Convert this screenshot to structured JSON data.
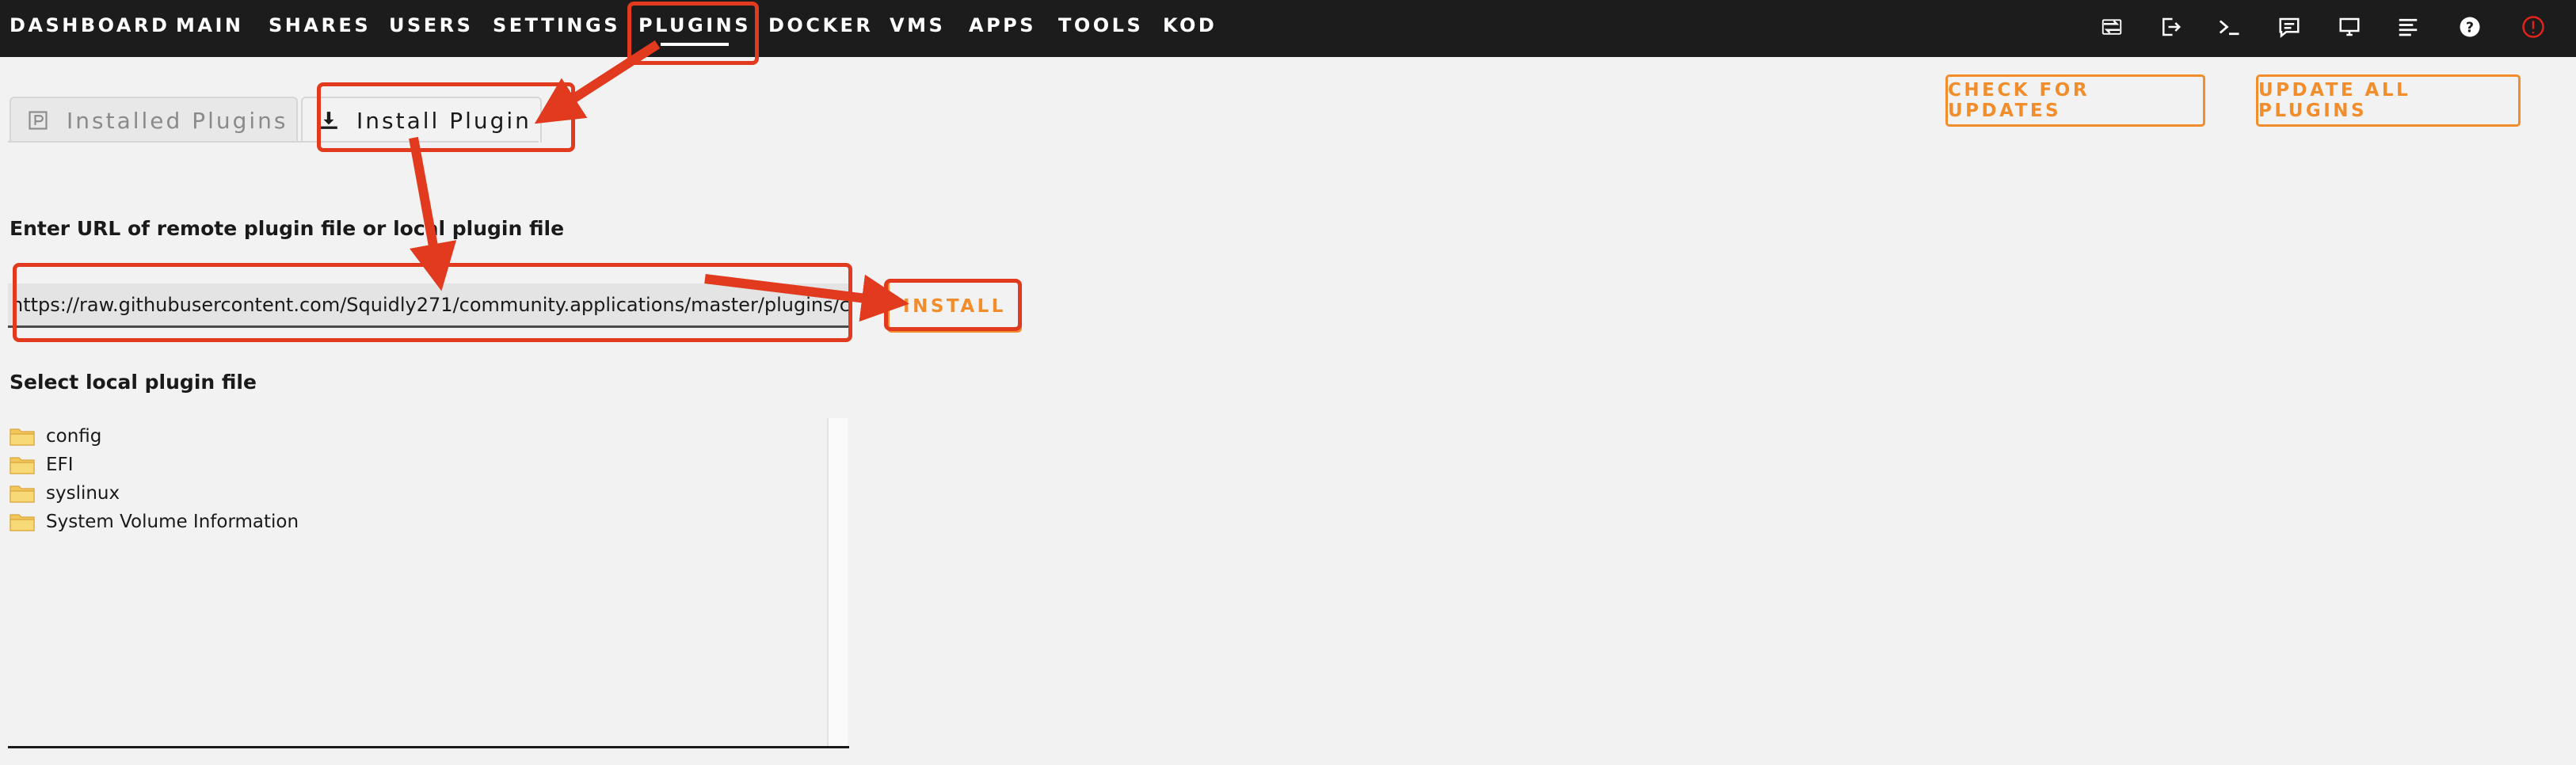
{
  "nav": {
    "items": [
      "DASHBOARD",
      "MAIN",
      "SHARES",
      "USERS",
      "SETTINGS",
      "PLUGINS",
      "DOCKER",
      "VMS",
      "APPS",
      "TOOLS",
      "KOD"
    ],
    "active": "PLUGINS",
    "icons": [
      "switch-icon",
      "logout-icon",
      "terminal-icon",
      "feedback-icon",
      "monitor-icon",
      "log-icon",
      "help-icon",
      "notification-alert-icon"
    ]
  },
  "tabs": [
    {
      "label": "Installed Plugins",
      "icon": "plugin-icon",
      "active": false
    },
    {
      "label": "Install Plugin",
      "icon": "download-icon",
      "active": true
    }
  ],
  "buttons": {
    "check_updates": "CHECK FOR UPDATES",
    "update_all": "UPDATE ALL PLUGINS",
    "install": "INSTALL"
  },
  "form": {
    "url_label": "Enter URL of remote plugin file or local plugin file",
    "url_value": "https://raw.githubusercontent.com/Squidly271/community.applications/master/plugins/c",
    "local_label": "Select local plugin file"
  },
  "files": [
    "config",
    "EFI",
    "syslinux",
    "System Volume Information"
  ],
  "colors": {
    "nav_bg": "#1c1c1c",
    "accent": "#f28d2c",
    "annotation": "#e13a1e",
    "alert": "#e2231a"
  }
}
